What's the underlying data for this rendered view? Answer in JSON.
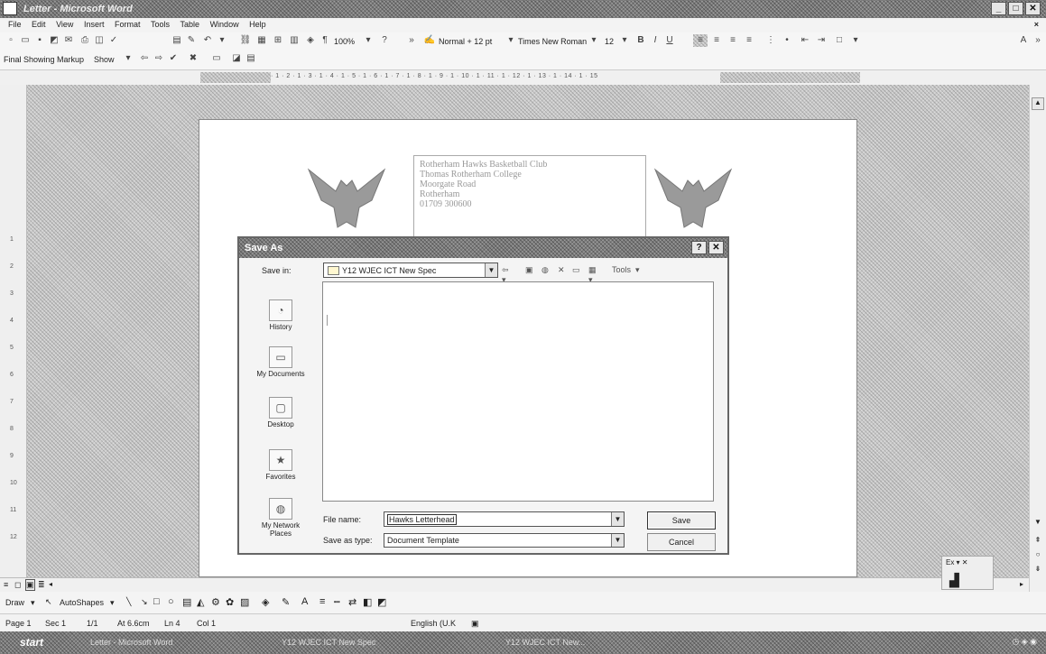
{
  "window": {
    "title": "Letter - Microsoft Word",
    "controls": [
      "_",
      "□",
      "✕"
    ]
  },
  "menu": [
    "File",
    "Edit",
    "View",
    "Insert",
    "Format",
    "Tools",
    "Table",
    "Window",
    "Help"
  ],
  "toolbar": {
    "zoom": "100%",
    "style": "Normal + 12 pt",
    "font": "Times New Roman",
    "size": "12",
    "bold": "B",
    "italic": "I",
    "underline": "U",
    "markup": "Final Showing Markup",
    "show": "Show"
  },
  "ruler": {
    "text": "· 1 · 2 · 1 · 3 · 1 · 4 · 1 · 5 · 1 · 6 · 1 · 7 · 1 · 8 · 1 · 9 · 1 · 10 · 1 · 11 · 1 · 12 · 1 · 13 · 1 · 14 · 1 · 15"
  },
  "vruler": [
    "1",
    "2",
    "3",
    "4",
    "5",
    "6",
    "7",
    "8",
    "9",
    "10",
    "11",
    "12"
  ],
  "document": {
    "address": [
      "Rotherham Hawks Basketball Club",
      "Thomas Rotherham College",
      "Moorgate Road",
      "Rotherham",
      "01709 300600"
    ]
  },
  "dialog": {
    "title": "Save As",
    "help": "?",
    "close": "✕",
    "save_in_label": "Save in:",
    "save_in_value": "Y12 WJEC ICT New Spec",
    "tools_label": "Tools",
    "places": [
      "History",
      "My Documents",
      "Desktop",
      "Favorites",
      "My Network Places"
    ],
    "file_name_label": "File name:",
    "file_name_value": "Hawks Letterhead",
    "save_as_type_label": "Save as type:",
    "save_as_type_value": "Document Template",
    "save_button": "Save",
    "cancel_button": "Cancel"
  },
  "drawbar": {
    "draw": "Draw",
    "autoshapes": "AutoShapes"
  },
  "status": {
    "page": "Page 1",
    "sec": "Sec 1",
    "pages": "1/1",
    "at": "At 6.6cm",
    "ln": "Ln 4",
    "col": "Col 1",
    "lang": "English (U.K"
  },
  "taskbar": {
    "start": "start",
    "tasks": [
      "Letter - Microsoft Word",
      "Y12 WJEC ICT New Spec",
      "Y12 WJEC ICT New..."
    ]
  }
}
